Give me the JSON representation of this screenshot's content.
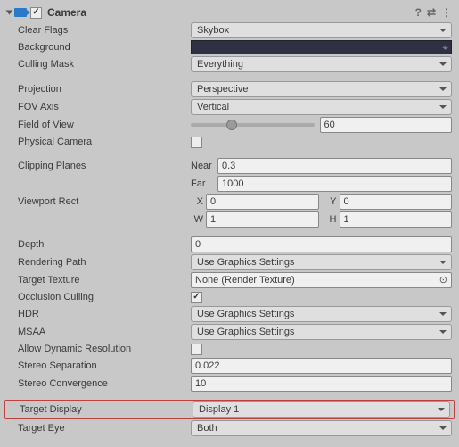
{
  "header": {
    "title": "Camera",
    "enabled": true
  },
  "clearFlags": {
    "label": "Clear Flags",
    "value": "Skybox"
  },
  "background": {
    "label": "Background",
    "color": "#2e3044"
  },
  "cullingMask": {
    "label": "Culling Mask",
    "value": "Everything"
  },
  "projection": {
    "label": "Projection",
    "value": "Perspective"
  },
  "fovAxis": {
    "label": "FOV Axis",
    "value": "Vertical"
  },
  "fieldOfView": {
    "label": "Field of View",
    "value": "60",
    "pct": 33
  },
  "physicalCamera": {
    "label": "Physical Camera",
    "checked": false
  },
  "clippingPlanes": {
    "label": "Clipping Planes",
    "nearLabel": "Near",
    "near": "0.3",
    "farLabel": "Far",
    "far": "1000"
  },
  "viewportRect": {
    "label": "Viewport Rect",
    "xLabel": "X",
    "x": "0",
    "yLabel": "Y",
    "y": "0",
    "wLabel": "W",
    "w": "1",
    "hLabel": "H",
    "h": "1"
  },
  "depth": {
    "label": "Depth",
    "value": "0"
  },
  "renderingPath": {
    "label": "Rendering Path",
    "value": "Use Graphics Settings"
  },
  "targetTexture": {
    "label": "Target Texture",
    "value": "None (Render Texture)"
  },
  "occlusionCulling": {
    "label": "Occlusion Culling",
    "checked": true
  },
  "hdr": {
    "label": "HDR",
    "value": "Use Graphics Settings"
  },
  "msaa": {
    "label": "MSAA",
    "value": "Use Graphics Settings"
  },
  "allowDynamicRes": {
    "label": "Allow Dynamic Resolution",
    "checked": false
  },
  "stereoSeparation": {
    "label": "Stereo Separation",
    "value": "0.022"
  },
  "stereoConvergence": {
    "label": "Stereo Convergence",
    "value": "10"
  },
  "targetDisplay": {
    "label": "Target Display",
    "value": "Display 1"
  },
  "targetEye": {
    "label": "Target Eye",
    "value": "Both"
  }
}
